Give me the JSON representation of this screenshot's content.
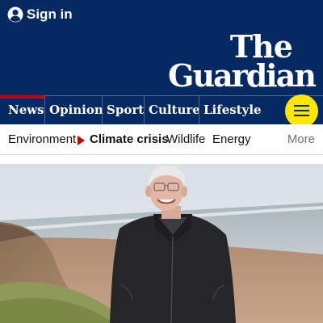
{
  "header": {
    "signin_label": "Sign in",
    "logo_line1": "The",
    "logo_line2": "Guardian",
    "brand_color": "#052962"
  },
  "nav": {
    "pillars": [
      {
        "label": "News",
        "active": true
      },
      {
        "label": "Opinion"
      },
      {
        "label": "Sport"
      },
      {
        "label": "Culture"
      },
      {
        "label": "Lifestyle"
      }
    ],
    "menu_icon": "hamburger-icon",
    "menu_color": "#ffe500"
  },
  "subnav": {
    "items": [
      {
        "label": "Environment"
      },
      {
        "label": "Climate crisis",
        "current": true
      },
      {
        "label": "Wildlife"
      },
      {
        "label": "Energy"
      }
    ],
    "more_label": "More",
    "accent_color": "#c70000"
  },
  "main": {
    "photo": "elderly man in dark fleece jacket standing on a beach by the sea"
  }
}
